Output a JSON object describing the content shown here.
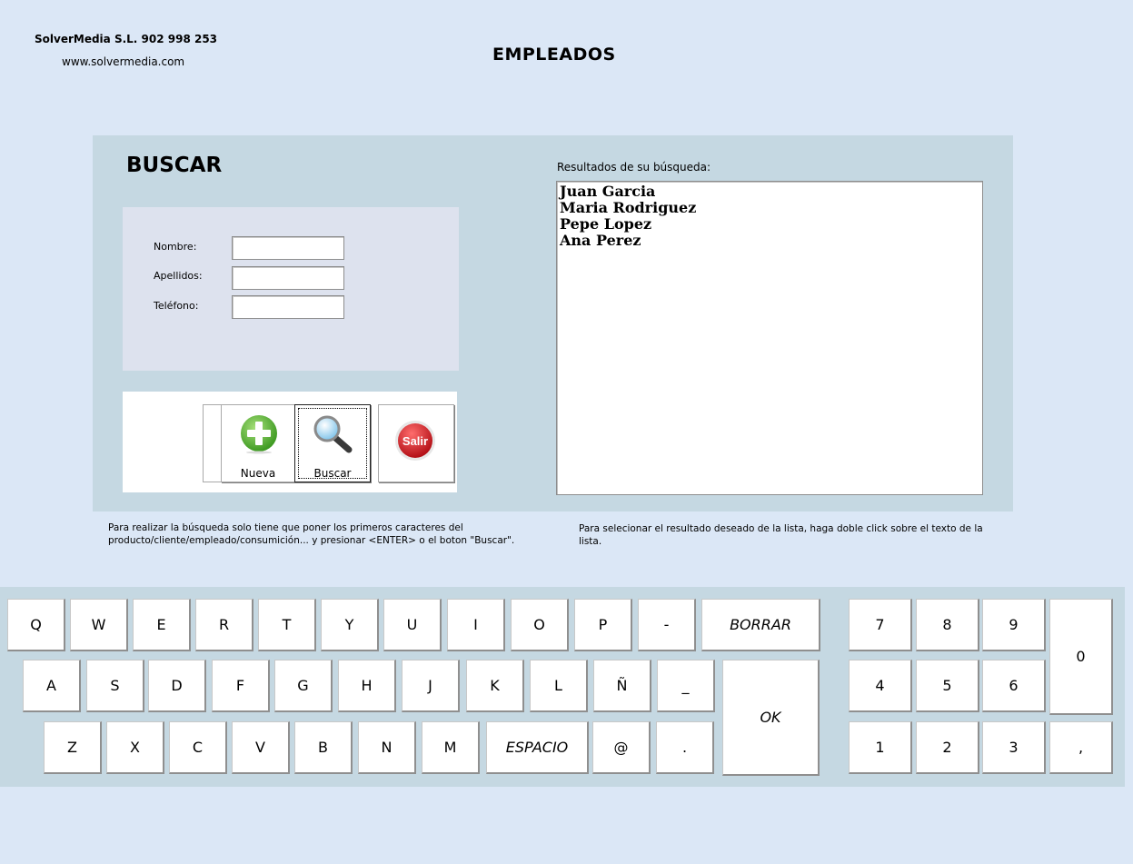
{
  "header": {
    "company": "SolverMedia S.L. 902 998 253",
    "website": "www.solvermedia.com",
    "page_title": "EMPLEADOS"
  },
  "search": {
    "title": "BUSCAR",
    "fields": {
      "nombre": {
        "label": "Nombre:",
        "value": ""
      },
      "apellidos": {
        "label": "Apellidos:",
        "value": ""
      },
      "telefono": {
        "label": "Teléfono:",
        "value": ""
      }
    },
    "buttons": {
      "nueva": {
        "label": "Nueva",
        "icon": "plus-icon"
      },
      "buscar": {
        "label": "Buscar",
        "icon": "magnifier-icon"
      },
      "salir": {
        "label": "Salir",
        "icon": "exit-icon"
      }
    }
  },
  "results": {
    "label": "Resultados de su búsqueda:",
    "items": [
      "Juan Garcia",
      "Maria Rodriguez",
      "Pepe Lopez",
      "Ana Perez"
    ]
  },
  "hints": {
    "left": "Para realizar la búsqueda solo tiene que poner los primeros caracteres del producto/cliente/empleado/consumición... y presionar <ENTER> o el boton \"Buscar\".",
    "right": "Para selecionar el resultado deseado de la lista, haga doble click sobre el texto de la lista."
  },
  "keyboard": {
    "row1": [
      "Q",
      "W",
      "E",
      "R",
      "T",
      "Y",
      "U",
      "I",
      "O",
      "P",
      "-"
    ],
    "row2": [
      "A",
      "S",
      "D",
      "F",
      "G",
      "H",
      "J",
      "K",
      "L",
      "Ñ",
      "_"
    ],
    "row3": [
      "Z",
      "X",
      "C",
      "V",
      "B",
      "N",
      "M",
      "ESPACIO",
      "@",
      "."
    ],
    "borrar": "BORRAR",
    "ok": "OK",
    "numpad": [
      "7",
      "8",
      "9",
      "4",
      "5",
      "6",
      "1",
      "2",
      "3"
    ],
    "zero": "0",
    "comma": ","
  },
  "colors": {
    "background": "#dbe7f6",
    "panel": "#c5d8e2",
    "form_box": "#dde2ee",
    "plus_green": "#5cb83a",
    "salir_red": "#d0202a"
  }
}
